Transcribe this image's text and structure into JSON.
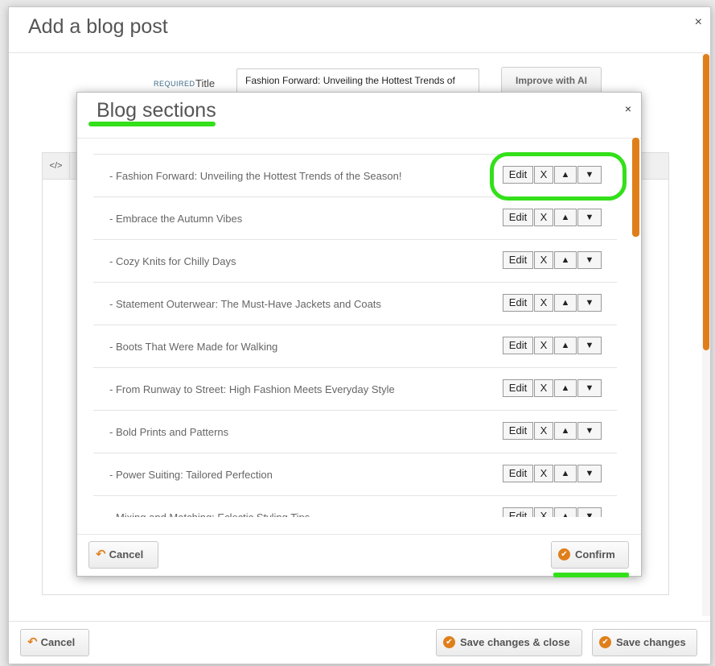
{
  "outer_modal": {
    "title": "Add a blog post",
    "close": "×",
    "required_label": "REQUIRED",
    "title_label": "Title",
    "title_value": "Fashion Forward: Unveiling the Hottest Trends of",
    "improve_label": "Improve with AI",
    "code_label": "</>",
    "footer": {
      "cancel_label": "Cancel",
      "save_close_label": "Save changes & close",
      "save_label": "Save changes"
    }
  },
  "inner_modal": {
    "title": "Blog sections",
    "close": "×",
    "sections": [
      "- Fashion Forward: Unveiling the Hottest Trends of the Season!",
      "- Embrace the Autumn Vibes",
      "- Cozy Knits for Chilly Days",
      "- Statement Outerwear: The Must-Have Jackets and Coats",
      "- Boots That Were Made for Walking",
      "- From Runway to Street: High Fashion Meets Everyday Style",
      "- Bold Prints and Patterns",
      "- Power Suiting: Tailored Perfection",
      "- Mixing and Matching: Eclectic Styling Tips"
    ],
    "row_buttons": {
      "edit": "Edit",
      "remove": "X",
      "up": "▲",
      "down": "▼"
    },
    "footer": {
      "cancel_label": "Cancel",
      "confirm_label": "Confirm"
    }
  },
  "colors": {
    "accent": "#e07f1a",
    "annotation": "#33e01a"
  },
  "icons": {
    "cancel": "undo-arrow-icon",
    "confirm": "check-circle-icon"
  }
}
